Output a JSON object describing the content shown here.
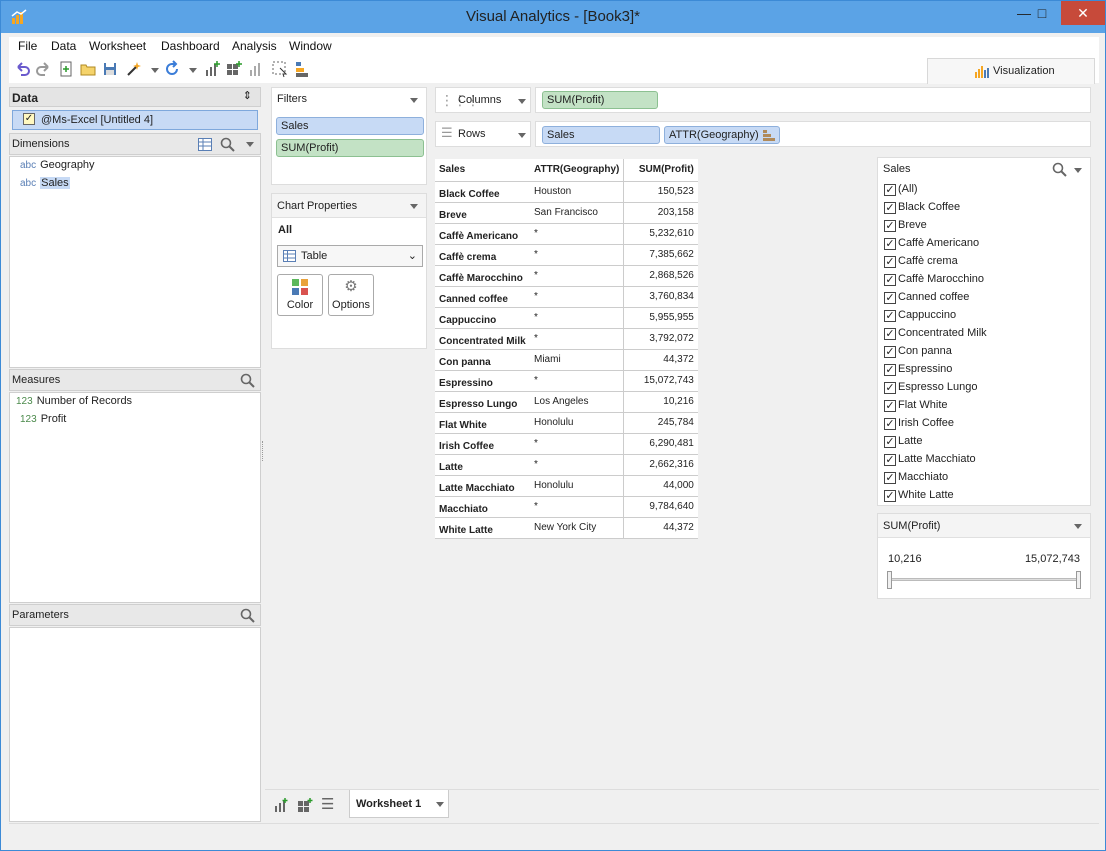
{
  "window": {
    "title": "Visual Analytics - [Book3]*"
  },
  "menu": [
    "File",
    "Data",
    "Worksheet",
    "Dashboard",
    "Analysis",
    "Window"
  ],
  "viz_tab": {
    "label": "Visualization"
  },
  "data_panel": {
    "title": "Data",
    "source": "@Ms-Excel [Untitled 4]",
    "dimensions_title": "Dimensions",
    "dimensions": [
      {
        "tag": "abc",
        "label": "Geography"
      },
      {
        "tag": "abc",
        "label": "Sales"
      }
    ],
    "measures_title": "Measures",
    "measures": [
      {
        "tag": "123",
        "label": "Number of Records"
      },
      {
        "tag": "123",
        "label": "Profit"
      }
    ],
    "parameters_title": "Parameters"
  },
  "filters": {
    "title": "Filters",
    "items": [
      "Sales",
      "SUM(Profit)"
    ]
  },
  "chart_properties": {
    "title": "Chart Properties",
    "all_label": "All",
    "chart_type": "Table",
    "color_label": "Color",
    "options_label": "Options"
  },
  "shelves": {
    "columns_label": "Columns",
    "columns_pills": [
      "SUM(Profit)"
    ],
    "rows_label": "Rows",
    "rows_pills": [
      "Sales",
      "ATTR(Geography)"
    ]
  },
  "table": {
    "headers": [
      "Sales",
      "ATTR(Geography)",
      "SUM(Profit)"
    ],
    "rows": [
      [
        "Black Coffee",
        "Houston",
        "150,523"
      ],
      [
        "Breve",
        "San Francisco",
        "203,158"
      ],
      [
        "Caffè Americano",
        "*",
        "5,232,610"
      ],
      [
        "Caffè crema",
        "*",
        "7,385,662"
      ],
      [
        "Caffè Marocchino",
        "*",
        "2,868,526"
      ],
      [
        "Canned coffee",
        "*",
        "3,760,834"
      ],
      [
        "Cappuccino",
        "*",
        "5,955,955"
      ],
      [
        "Concentrated Milk",
        "*",
        "3,792,072"
      ],
      [
        "Con panna",
        "Miami",
        "44,372"
      ],
      [
        "Espressino",
        "*",
        "15,072,743"
      ],
      [
        "Espresso Lungo",
        "Los Angeles",
        "10,216"
      ],
      [
        "Flat White",
        "Honolulu",
        "245,784"
      ],
      [
        "Irish Coffee",
        "*",
        "6,290,481"
      ],
      [
        "Latte",
        "*",
        "2,662,316"
      ],
      [
        "Latte Macchiato",
        "Honolulu",
        "44,000"
      ],
      [
        "Macchiato",
        "*",
        "9,784,640"
      ],
      [
        "White Latte",
        "New York City",
        "44,372"
      ]
    ]
  },
  "sales_filter": {
    "title": "Sales",
    "items": [
      "(All)",
      "Black Coffee",
      "Breve",
      "Caffè Americano",
      "Caffè crema",
      "Caffè Marocchino",
      "Canned coffee",
      "Cappuccino",
      "Concentrated Milk",
      "Con panna",
      "Espressino",
      "Espresso Lungo",
      "Flat White",
      "Irish Coffee",
      "Latte",
      "Latte Macchiato",
      "Macchiato",
      "White Latte"
    ]
  },
  "profit_filter": {
    "title": "SUM(Profit)",
    "min": "10,216",
    "max": "15,072,743"
  },
  "sheet_tab": {
    "label": "Worksheet 1"
  },
  "colors": {
    "titlebar": "#5ba3e6",
    "pill_blue": "#c7daf5",
    "pill_green": "#c3e2c5",
    "close": "#c74a3a"
  }
}
